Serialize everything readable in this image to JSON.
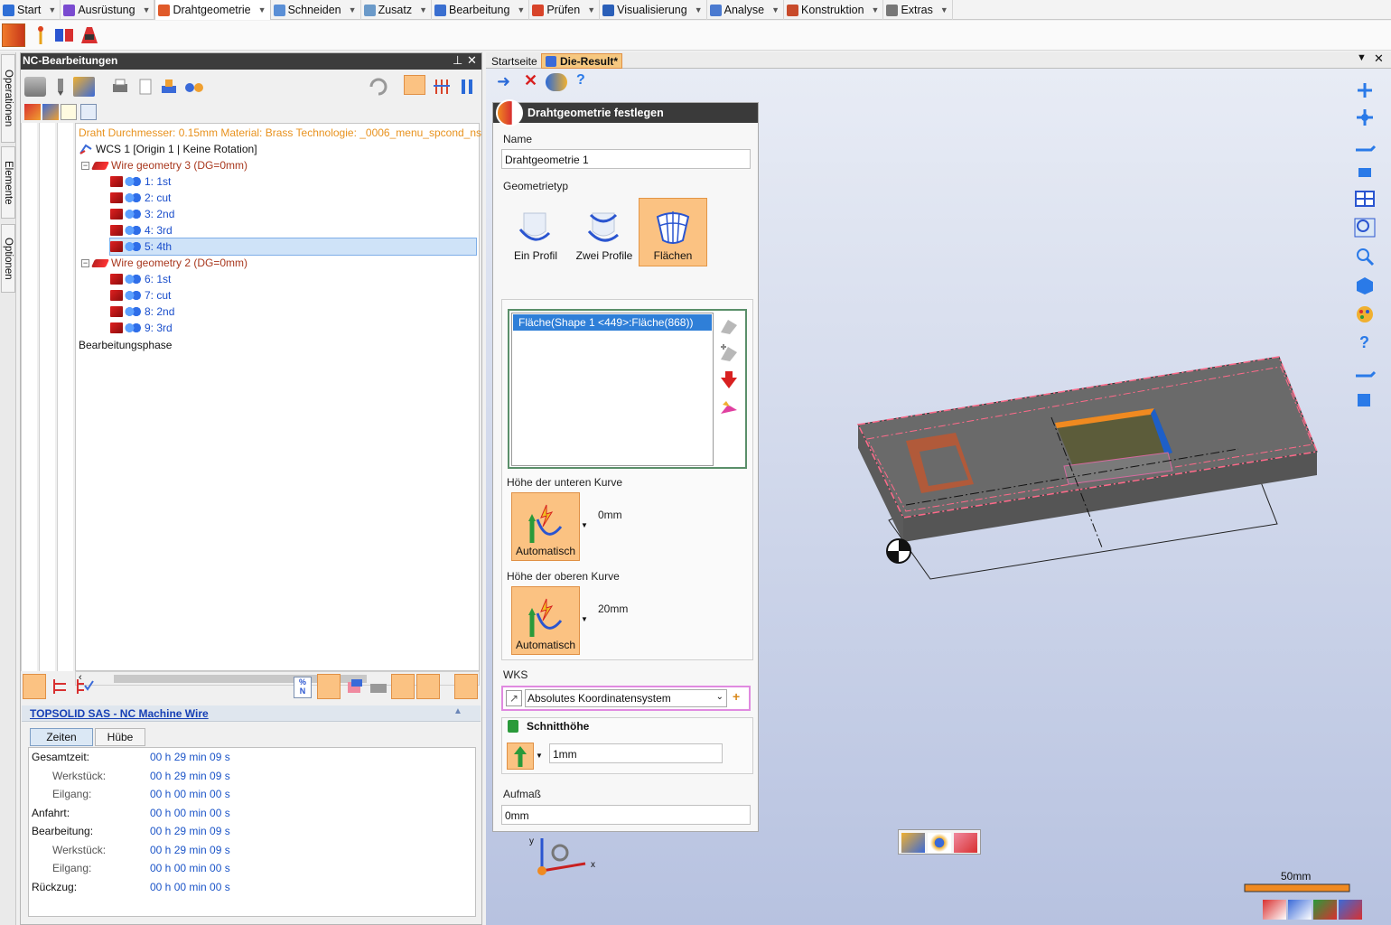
{
  "ribbon": {
    "tabs": [
      {
        "label": "Start",
        "color": "#2f6fd6"
      },
      {
        "label": "Ausrüstung",
        "color": "#7a4bd0"
      },
      {
        "label": "Drahtgeometrie",
        "color": "#e05a2a"
      },
      {
        "label": "Schneiden",
        "color": "#5a8fd6"
      },
      {
        "label": "Zusatz",
        "color": "#6b9ac9"
      },
      {
        "label": "Bearbeitung",
        "color": "#3a6fd0"
      },
      {
        "label": "Prüfen",
        "color": "#d8442a"
      },
      {
        "label": "Visualisierung",
        "color": "#2a5fb8"
      },
      {
        "label": "Analyse",
        "color": "#4a7ad0"
      },
      {
        "label": "Konstruktion",
        "color": "#c84a2a"
      },
      {
        "label": "Extras",
        "color": "#777777"
      }
    ],
    "active_tab": "Drahtgeometrie"
  },
  "side_tabs": [
    "Operationen",
    "Elemente",
    "Optionen"
  ],
  "nc_panel": {
    "title": "NC-Bearbeitungen",
    "pin_icon": "pin-icon",
    "close_icon": "close-icon",
    "tree": {
      "info_line": "Draht Durchmesser: 0.15mm Material: Brass Technologie: _0006_menu_spcond_ns",
      "wcs": "WCS 1 [Origin 1 | Keine Rotation]",
      "groups": [
        {
          "label": "Wire geometry 3 (DG=0mm)",
          "ops": [
            "1: 1st",
            "2: cut",
            "3: 2nd",
            "4: 3rd",
            "5: 4th"
          ]
        },
        {
          "label": "Wire geometry 2 (DG=0mm)",
          "ops": [
            "6: 1st",
            "7: cut",
            "8: 2nd",
            "9: 3rd"
          ]
        }
      ],
      "selected": "5: 4th",
      "phase": "Bearbeitungsphase"
    }
  },
  "time_panel": {
    "title": "TOPSOLID SAS - NC Machine Wire",
    "tabs": [
      "Zeiten",
      "Hübe"
    ],
    "active_tab": "Zeiten",
    "rows": [
      {
        "label": "Gesamtzeit:",
        "value": "00 h 29 min 09 s",
        "indent": false
      },
      {
        "label": "Werkstück:",
        "value": "00 h 29 min 09 s",
        "indent": true
      },
      {
        "label": "Eilgang:",
        "value": "00 h 00 min 00 s",
        "indent": true
      },
      {
        "label": "Anfahrt:",
        "value": "00 h 00 min 00 s",
        "indent": false
      },
      {
        "label": "Bearbeitung:",
        "value": "00 h 29 min 09 s",
        "indent": false
      },
      {
        "label": "Werkstück:",
        "value": "00 h 29 min 09 s",
        "indent": true
      },
      {
        "label": "Eilgang:",
        "value": "00 h 00 min 00 s",
        "indent": true
      },
      {
        "label": "Rückzug:",
        "value": "00 h 00 min 00 s",
        "indent": false
      }
    ]
  },
  "doc_tabs": [
    {
      "label": "Startseite",
      "active": false
    },
    {
      "label": "Die-Result*",
      "active": true
    }
  ],
  "dialog": {
    "title": "Drahtgeometrie festlegen",
    "name_label": "Name",
    "name_value": "Drahtgeometrie 1",
    "geotype_label": "Geometrietyp",
    "geotypes": [
      {
        "label": "Ein Profil",
        "selected": false
      },
      {
        "label": "Zwei Profile",
        "selected": false
      },
      {
        "label": "Flächen",
        "selected": true
      }
    ],
    "face_list": [
      "Fläche(Shape 1 <449>:Fläche(868))"
    ],
    "lower_curve_label": "Höhe der unteren Kurve",
    "lower_curve_button": "Automatisch",
    "lower_curve_value": "0mm",
    "upper_curve_label": "Höhe der oberen Kurve",
    "upper_curve_button": "Automatisch",
    "upper_curve_value": "20mm",
    "wks_label": "WKS",
    "wks_value": "Absolutes Koordinatensystem",
    "cut_height_label": "Schnitthöhe",
    "cut_height_value": "1mm",
    "allowance_label": "Aufmaß",
    "allowance_value": "0mm"
  },
  "viewport": {
    "scale_label": "50mm",
    "axis_x": "x",
    "axis_y": "y",
    "accent": "#ff8c00"
  }
}
